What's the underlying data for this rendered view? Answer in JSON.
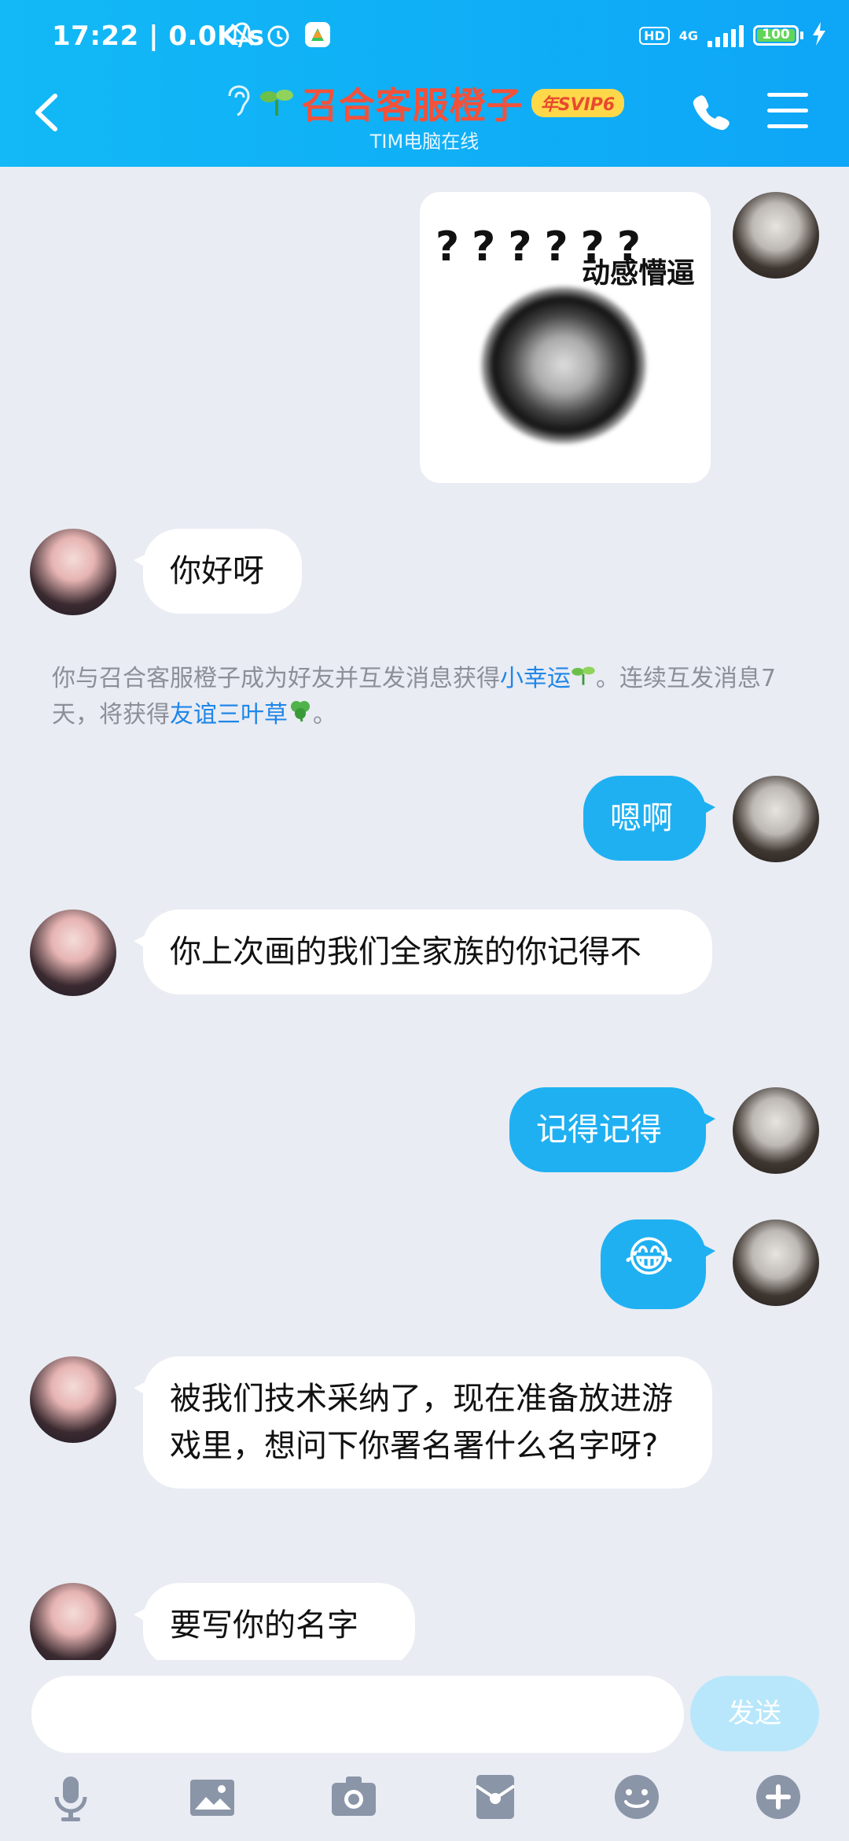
{
  "status": {
    "time": "17:22 | 0.0K/s",
    "hd": "HD",
    "network": "4G",
    "battery": "100"
  },
  "header": {
    "contact_name": "召合客服橙子",
    "vip_badge": "年SVIP6",
    "subtitle": "TIM电脑在线"
  },
  "sticker": {
    "question_marks": "??????",
    "caption": "动感懵逼"
  },
  "messages": {
    "m1": "你好呀",
    "m2": "嗯啊",
    "m3": "你上次画的我们全家族的你记得不",
    "m4": "记得记得",
    "m5": "😂",
    "m6": "被我们技术采纳了，现在准备放进游戏里，想问下你署名署什么名字呀?",
    "m7": "要写你的名字"
  },
  "system_notice": {
    "part1": "你与召合客服橙子成为好友并互发消息获得",
    "link1": "小幸运",
    "part2": "。连续互发消息7天，将获得",
    "link2": "友谊三叶草",
    "part3": "。"
  },
  "input": {
    "placeholder": "",
    "send_label": "发送"
  },
  "colors": {
    "header": "#12b9f6",
    "outgoing_bubble": "#1fb0f2",
    "title": "#f2513a",
    "link": "#1f86e8"
  },
  "toolbar_icons": [
    "microphone-icon",
    "image-icon",
    "camera-icon",
    "red-packet-icon",
    "emoji-icon",
    "plus-icon"
  ]
}
